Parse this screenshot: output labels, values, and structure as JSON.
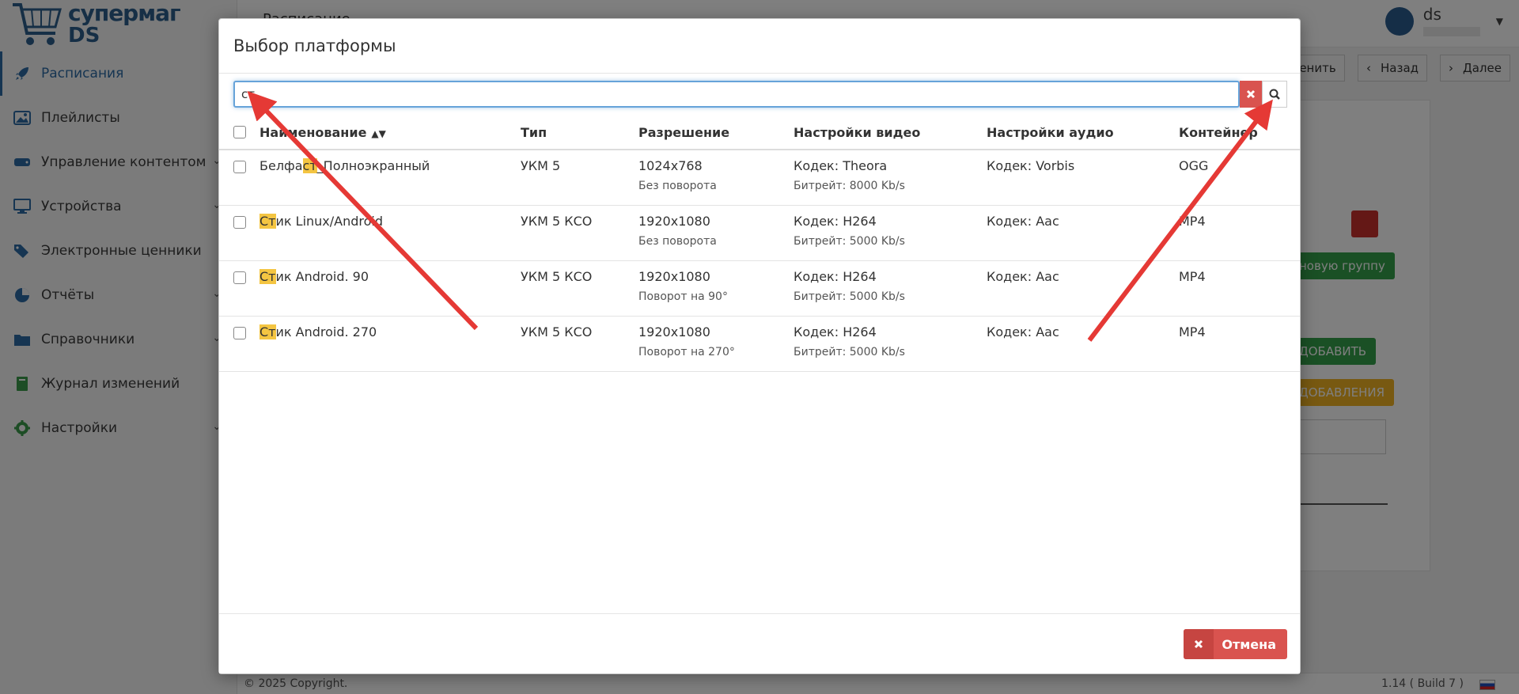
{
  "app": {
    "logo_line1": "супермаг",
    "logo_line2": "DS",
    "page_title": "Расписание",
    "user_name": "ds"
  },
  "sidebar": {
    "items": [
      {
        "label": "Расписания",
        "icon": "rocket-icon",
        "active": true
      },
      {
        "label": "Плейлисты",
        "icon": "images-icon"
      },
      {
        "label": "Управление контентом",
        "icon": "drive-icon"
      },
      {
        "label": "Устройства",
        "icon": "monitor-icon"
      },
      {
        "label": "Электронные ценники",
        "icon": "tags-icon"
      },
      {
        "label": "Отчёты",
        "icon": "pie-chart-icon"
      },
      {
        "label": "Справочники",
        "icon": "folder-icon"
      },
      {
        "label": "Журнал изменений",
        "icon": "book-icon"
      },
      {
        "label": "Настройки",
        "icon": "gear-icon"
      }
    ]
  },
  "background": {
    "btn_change": "менить",
    "btn_back": "Назад",
    "btn_next": "Далее",
    "btn_new_group": "новую группу",
    "btn_add": "ДОБАВИТЬ",
    "btn_adding": "ДОБАВЛЕНИЯ"
  },
  "footer": {
    "copyright": "© 2025 Copyright.",
    "version": "1.14 ( Build 7 )"
  },
  "modal": {
    "title": "Выбор платформы",
    "search_value": "ст",
    "columns": [
      "Наименование",
      "Тип",
      "Разрешение",
      "Настройки видео",
      "Настройки аудио",
      "Контейнер"
    ],
    "rows": [
      {
        "name_pre": "Белфа",
        "name_hl": "ст",
        "name_post": "_Полноэкранный",
        "type": "УКМ 5",
        "resolution": "1024x768",
        "rotation": "Без поворота",
        "video_codec": "Кодек: Theora",
        "bitrate": "Битрейт: 8000 Kb/s",
        "audio_codec": "Кодек: Vorbis",
        "container": "OGG"
      },
      {
        "name_pre": "",
        "name_hl": "Ст",
        "name_post": "ик Linux/Android",
        "type": "УКМ 5 КСО",
        "resolution": "1920x1080",
        "rotation": "Без поворота",
        "video_codec": "Кодек: H264",
        "bitrate": "Битрейт: 5000 Kb/s",
        "audio_codec": "Кодек: Aac",
        "container": "MP4"
      },
      {
        "name_pre": "",
        "name_hl": "Ст",
        "name_post": "ик Android. 90",
        "type": "УКМ 5 КСО",
        "resolution": "1920x1080",
        "rotation": "Поворот на 90°",
        "video_codec": "Кодек: H264",
        "bitrate": "Битрейт: 5000 Kb/s",
        "audio_codec": "Кодек: Aac",
        "container": "MP4"
      },
      {
        "name_pre": "",
        "name_hl": "Ст",
        "name_post": "ик Android. 270",
        "type": "УКМ 5 КСО",
        "resolution": "1920x1080",
        "rotation": "Поворот на 270°",
        "video_codec": "Кодек: H264",
        "bitrate": "Битрейт: 5000 Kb/s",
        "audio_codec": "Кодек: Aac",
        "container": "MP4"
      }
    ],
    "cancel_label": "Отмена"
  },
  "colors": {
    "accent": "#2c6aa5",
    "danger": "#d9534f",
    "highlight": "#f4c542",
    "annotation_arrow": "#e53935"
  }
}
